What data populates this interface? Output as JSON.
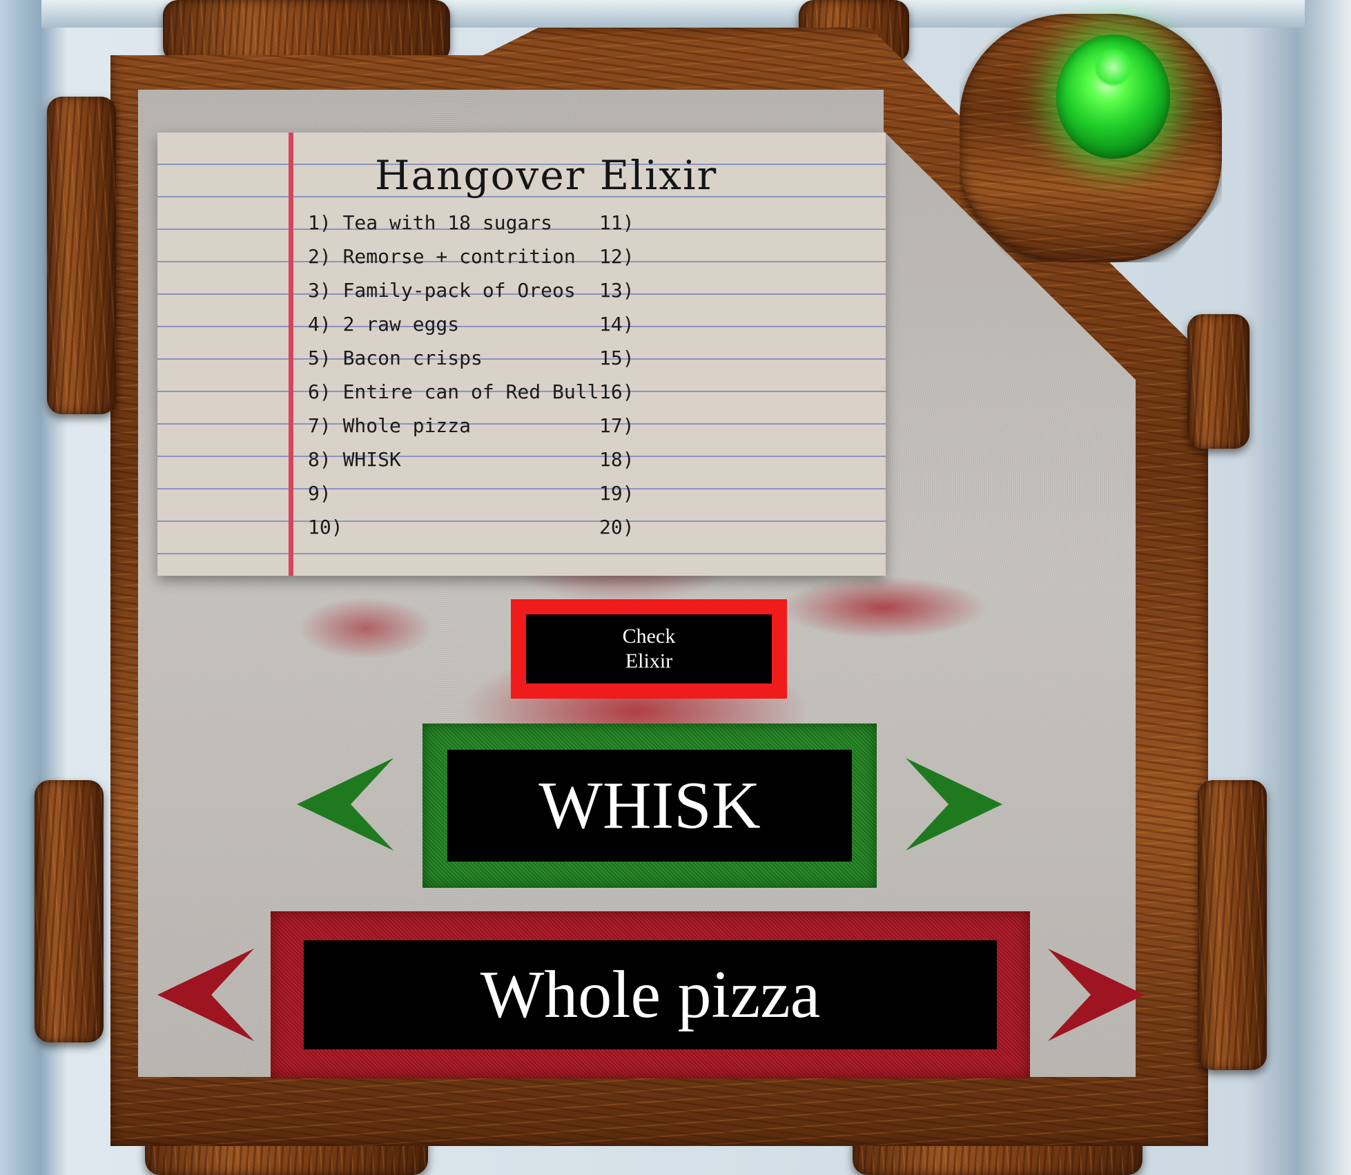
{
  "recipe_card": {
    "title": "Hangover Elixir",
    "left_items": [
      "1) Tea with 18 sugars",
      "2) Remorse + contrition",
      "3) Family-pack of Oreos",
      "4) 2 raw eggs",
      "5) Bacon crisps",
      "6) Entire can of Red Bull",
      "7) Whole pizza",
      "8) WHISK",
      "9)",
      "10)"
    ],
    "right_items": [
      "11)",
      "12)",
      "13)",
      "14)",
      "15)",
      "16)",
      "17)",
      "18)",
      "19)",
      "20)"
    ]
  },
  "check_button": {
    "line1": "Check",
    "line2": "Elixir"
  },
  "top_selector": {
    "value": "WHISK",
    "frame_color": "#2b8d2b"
  },
  "bottom_selector": {
    "value": "Whole pizza",
    "frame_color": "#b21f2c"
  },
  "colors": {
    "check_border": "#f01b1b",
    "green_arrow": "#1f7a1f",
    "red_arrow": "#9e1420",
    "jewel": "#3dff45"
  },
  "icons": {
    "prev_arrow": "triangle-left",
    "next_arrow": "triangle-right",
    "jewel": "green-gem"
  }
}
